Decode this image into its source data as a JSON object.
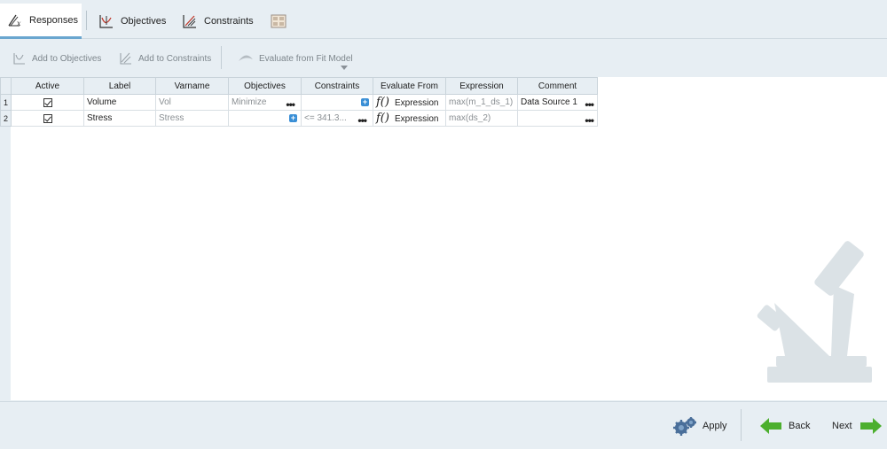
{
  "tabs": [
    {
      "label": "Responses",
      "icon": "responses-icon",
      "active": true
    },
    {
      "label": "Objectives",
      "icon": "objectives-icon",
      "active": false
    },
    {
      "label": "Constraints",
      "icon": "constraints-icon",
      "active": false
    }
  ],
  "tab_extra_icon": "layout-grid-icon",
  "toolbar": {
    "add_objectives": "Add to Objectives",
    "add_constraints": "Add to Constraints",
    "evaluate_fit": "Evaluate from Fit Model"
  },
  "table": {
    "headers": [
      "Active",
      "Label",
      "Varname",
      "Objectives",
      "Constraints",
      "Evaluate From",
      "Expression",
      "Comment"
    ],
    "rows": [
      {
        "num": "1",
        "active": true,
        "label": "Volume",
        "varname": "Vol",
        "objectives": "Minimize",
        "constraints": "",
        "evaluate_from": "Expression",
        "expression": "max(m_1_ds_1)",
        "comment": "Data Source 1"
      },
      {
        "num": "2",
        "active": true,
        "label": "Stress",
        "varname": "Stress",
        "objectives": "",
        "constraints": "<= 341.3...",
        "evaluate_from": "Expression",
        "expression": "max(ds_2)",
        "comment": ""
      }
    ]
  },
  "fx_symbol": "f()",
  "footer": {
    "apply": "Apply",
    "back": "Back",
    "next": "Next"
  },
  "colors": {
    "accent": "#6aa6cf",
    "arrow_green": "#4caf2e",
    "plus_blue": "#3a8fd6"
  }
}
